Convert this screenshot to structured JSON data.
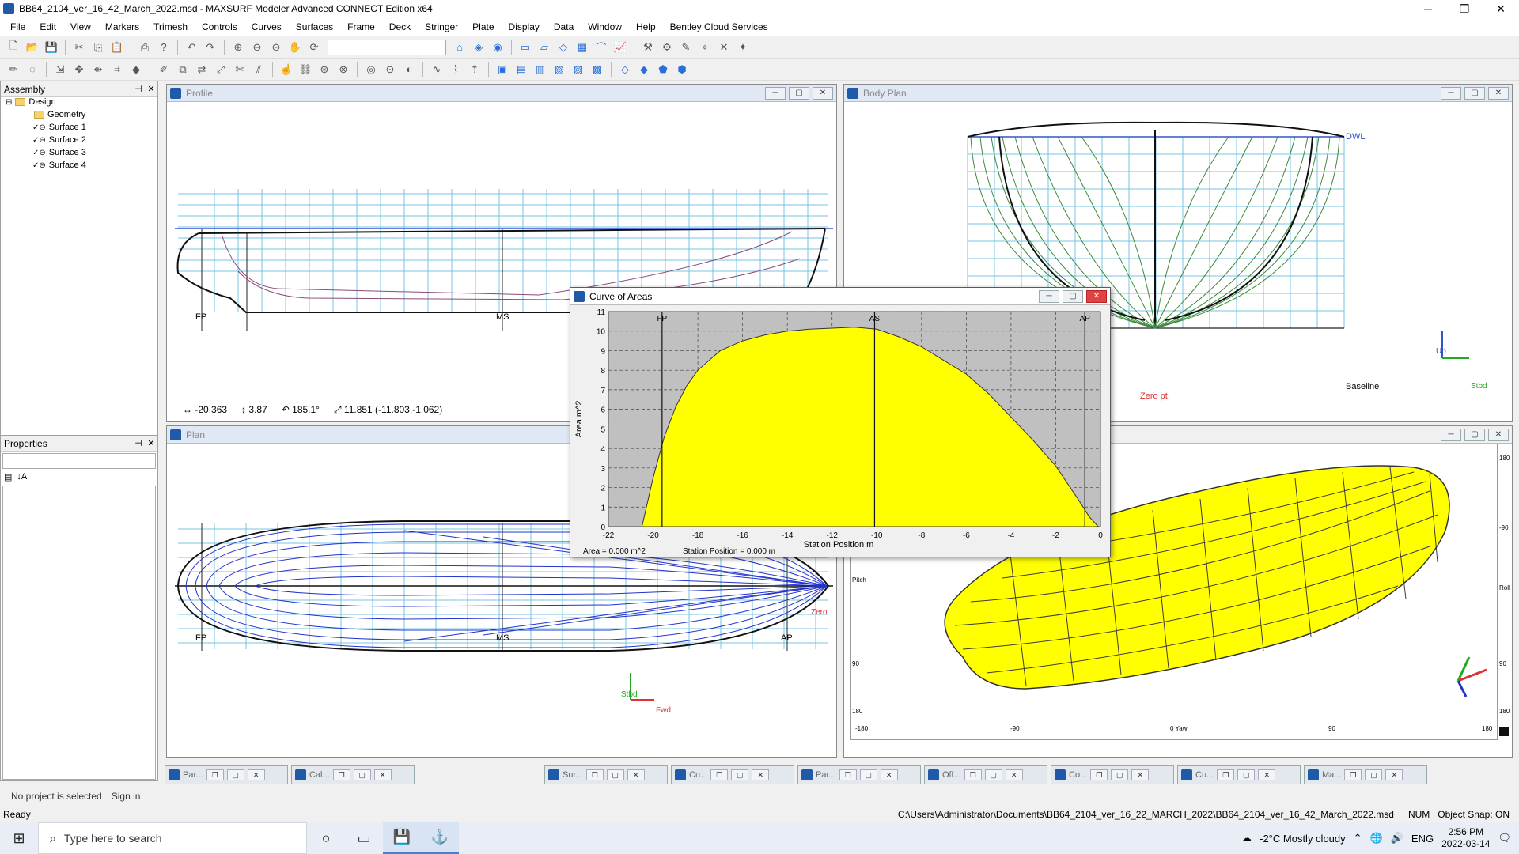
{
  "window": {
    "title": "BB64_2104_ver_16_42_March_2022.msd - MAXSURF Modeler Advanced CONNECT Edition x64",
    "min": "─",
    "max": "❐",
    "close": "✕"
  },
  "menu": [
    "File",
    "Edit",
    "View",
    "Markers",
    "Trimesh",
    "Controls",
    "Curves",
    "Surfaces",
    "Frame",
    "Deck",
    "Stringer",
    "Plate",
    "Display",
    "Data",
    "Window",
    "Help",
    "Bentley Cloud Services"
  ],
  "assembly": {
    "title": "Assembly",
    "root": "Design",
    "items": [
      "Geometry",
      "Surface 1",
      "Surface 2",
      "Surface 3",
      "Surface 4"
    ]
  },
  "properties": {
    "title": "Properties"
  },
  "views": {
    "profile": {
      "title": "Profile",
      "labels": [
        "FP",
        "MS"
      ],
      "readout": {
        "dx": "-20.363",
        "dz": "3.87",
        "angle": "185.1°",
        "dist": "11.851 (-11.803,-1.062)"
      }
    },
    "body": {
      "title": "Body Plan",
      "dwl": "DWL",
      "baseline": "Baseline",
      "zero": "Zero pt.",
      "up": "Up",
      "stbd": "Stbd"
    },
    "plan": {
      "title": "Plan",
      "labels": [
        "FP",
        "MS",
        "AP"
      ],
      "stbd": "Stbd",
      "fwd": "Fwd",
      "zero": "Zero"
    },
    "render": {
      "ruler_bottom": [
        "-180",
        "-90",
        "0 Yaw",
        "90",
        "180"
      ],
      "ruler_right": [
        "180",
        "-90",
        "Roll",
        "90",
        "180"
      ],
      "ruler_left": [
        "Pitch",
        "90",
        "180"
      ]
    }
  },
  "curve_of_areas": {
    "title": "Curve of Areas",
    "ylabel": "Area  m^2",
    "xlabel": "Station Position  m",
    "markers": [
      "FP",
      "AS",
      "AP"
    ],
    "area_label": "Area =  0.000 m^2",
    "station_label": "Station Position =  0.000 m",
    "chart_data": {
      "type": "area",
      "xlim": [
        -22,
        0
      ],
      "ylim": [
        0,
        11
      ],
      "xticks": [
        -22,
        -20,
        -18,
        -16,
        -14,
        -12,
        -10,
        -8,
        -6,
        -4,
        -2,
        0
      ],
      "yticks": [
        0,
        1,
        2,
        3,
        4,
        5,
        6,
        7,
        8,
        9,
        10,
        11
      ],
      "x": [
        -20.5,
        -20,
        -19.5,
        -19,
        -18.5,
        -18,
        -17,
        -16,
        -15,
        -14,
        -13,
        -12,
        -11,
        -10,
        -9,
        -8,
        -7,
        -6,
        -5,
        -4,
        -3,
        -2,
        -1,
        -0.5,
        -0.1
      ],
      "y": [
        0,
        2.5,
        4.6,
        6.1,
        7.2,
        8.0,
        9.0,
        9.5,
        9.8,
        10.0,
        10.1,
        10.15,
        10.2,
        10.1,
        9.7,
        9.2,
        8.5,
        7.8,
        6.8,
        5.6,
        4.4,
        3.1,
        1.4,
        0.5,
        0
      ]
    }
  },
  "mdi_tabs": [
    "Par...",
    "Cal...",
    "Sur...",
    "Cu...",
    "Par...",
    "Off...",
    "Co...",
    "Cu...",
    "Ma..."
  ],
  "status": {
    "ready": "Ready",
    "path": "C:\\Users\\Administrator\\Documents\\BB64_2104_ver_16_22_MARCH_2022\\BB64_2104_ver_16_42_March_2022.msd",
    "num": "NUM",
    "snap": "Object Snap: ON",
    "project": "No project is selected",
    "signin": "Sign in"
  },
  "taskbar": {
    "search": "Type here to search",
    "weather": "-2°C  Mostly cloudy",
    "lang": "ENG",
    "time": "2:56 PM",
    "date": "2022-03-14"
  }
}
